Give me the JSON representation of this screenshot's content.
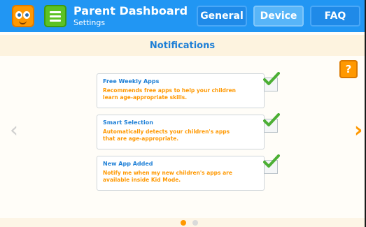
{
  "header": {
    "title": "Parent Dashboard",
    "subtitle": "Settings",
    "tabs": [
      {
        "label": "General",
        "active": false
      },
      {
        "label": "Device",
        "active": true
      },
      {
        "label": "FAQ",
        "active": false
      }
    ]
  },
  "page": {
    "heading": "Notifications",
    "help_label": "?"
  },
  "settings": [
    {
      "title": "Free Weekly Apps",
      "description": "Recommends free apps to help your children learn age-appropriate skills.",
      "checked": true
    },
    {
      "title": "Smart Selection",
      "description": "Automatically detects your children's apps that are age-appropriate.",
      "checked": true
    },
    {
      "title": "New App Added",
      "description": "Notify me when my new children's apps are available inside Kid Mode.",
      "checked": true
    }
  ],
  "pagination": {
    "current": 1,
    "total": 2
  },
  "colors": {
    "header": "#2196f3",
    "accent": "#ff9800",
    "title_blue": "#1e7fd6",
    "menu_green": "#5cc224"
  },
  "icons": {
    "logo": "kid-mode-face-icon",
    "menu": "hamburger-menu-icon",
    "prev": "chevron-left-icon",
    "next": "chevron-right-icon",
    "check": "checkmark-icon"
  }
}
